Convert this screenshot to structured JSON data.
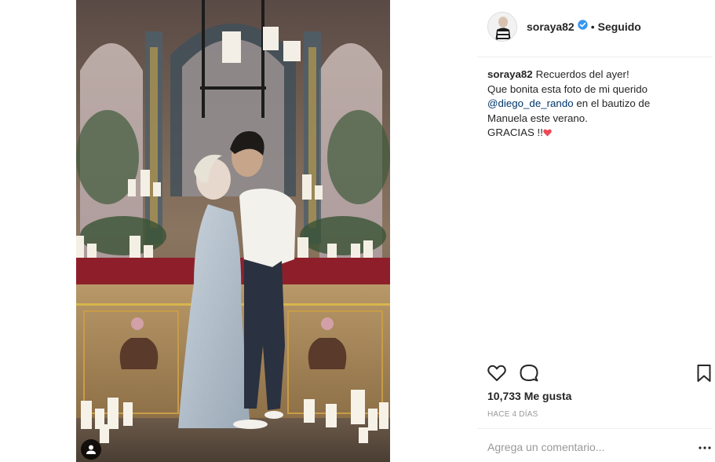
{
  "post": {
    "author": "soraya82",
    "verified": true,
    "follow_status": "Seguido",
    "separator": "•",
    "caption_lines": [
      "Recuerdos del ayer!",
      "Que bonita esta foto de mi querido",
      "@diego_de_rando",
      "en el bautizo de",
      "Manuela este verano.",
      "GRACIAS !!"
    ],
    "likes": "10,733 Me gusta",
    "time": "HACE 4 DÍAS",
    "comment_placeholder": "Agrega un comentario...",
    "more_label": "•••"
  },
  "colors": {
    "text": "#262626",
    "muted": "#999999",
    "mention": "#003569",
    "verified": "#3897f0",
    "heart_emoji": "#ed4956"
  },
  "icons": [
    "user-tag-icon",
    "verified-badge-icon",
    "like-heart-icon",
    "comment-icon",
    "save-bookmark-icon",
    "more-options-icon"
  ]
}
